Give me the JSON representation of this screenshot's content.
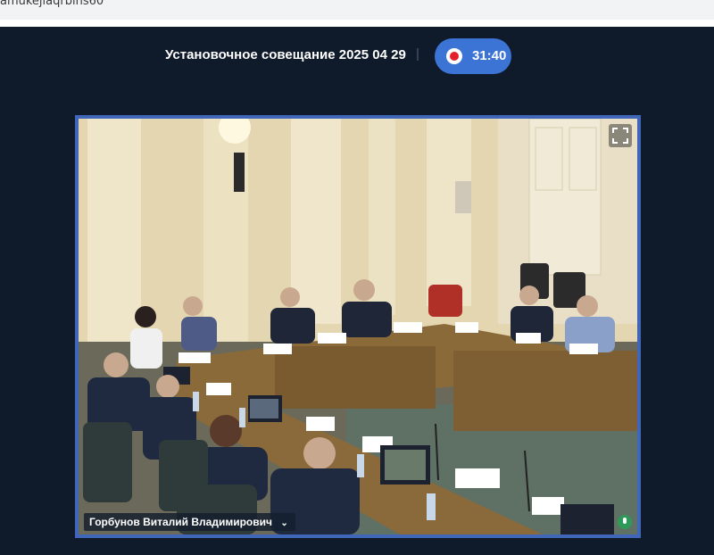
{
  "browser": {
    "url_fragment": "amukejlaqrbins60"
  },
  "meeting": {
    "title": "Установочное совещание 2025 04 29",
    "separator": "|",
    "recording": {
      "time": "31:40",
      "icon": "record-icon",
      "color": "#e4212b"
    }
  },
  "video": {
    "speaker_name": "Горбунов Виталий Владимирович",
    "chevron": "⌄",
    "fullscreen_icon": "fullscreen-icon",
    "mic_icon": "mic-icon",
    "frame_color": "#3f66b8"
  },
  "colors": {
    "background": "#0f1a2a",
    "accent": "#3c74d6",
    "text": "#ffffff"
  }
}
